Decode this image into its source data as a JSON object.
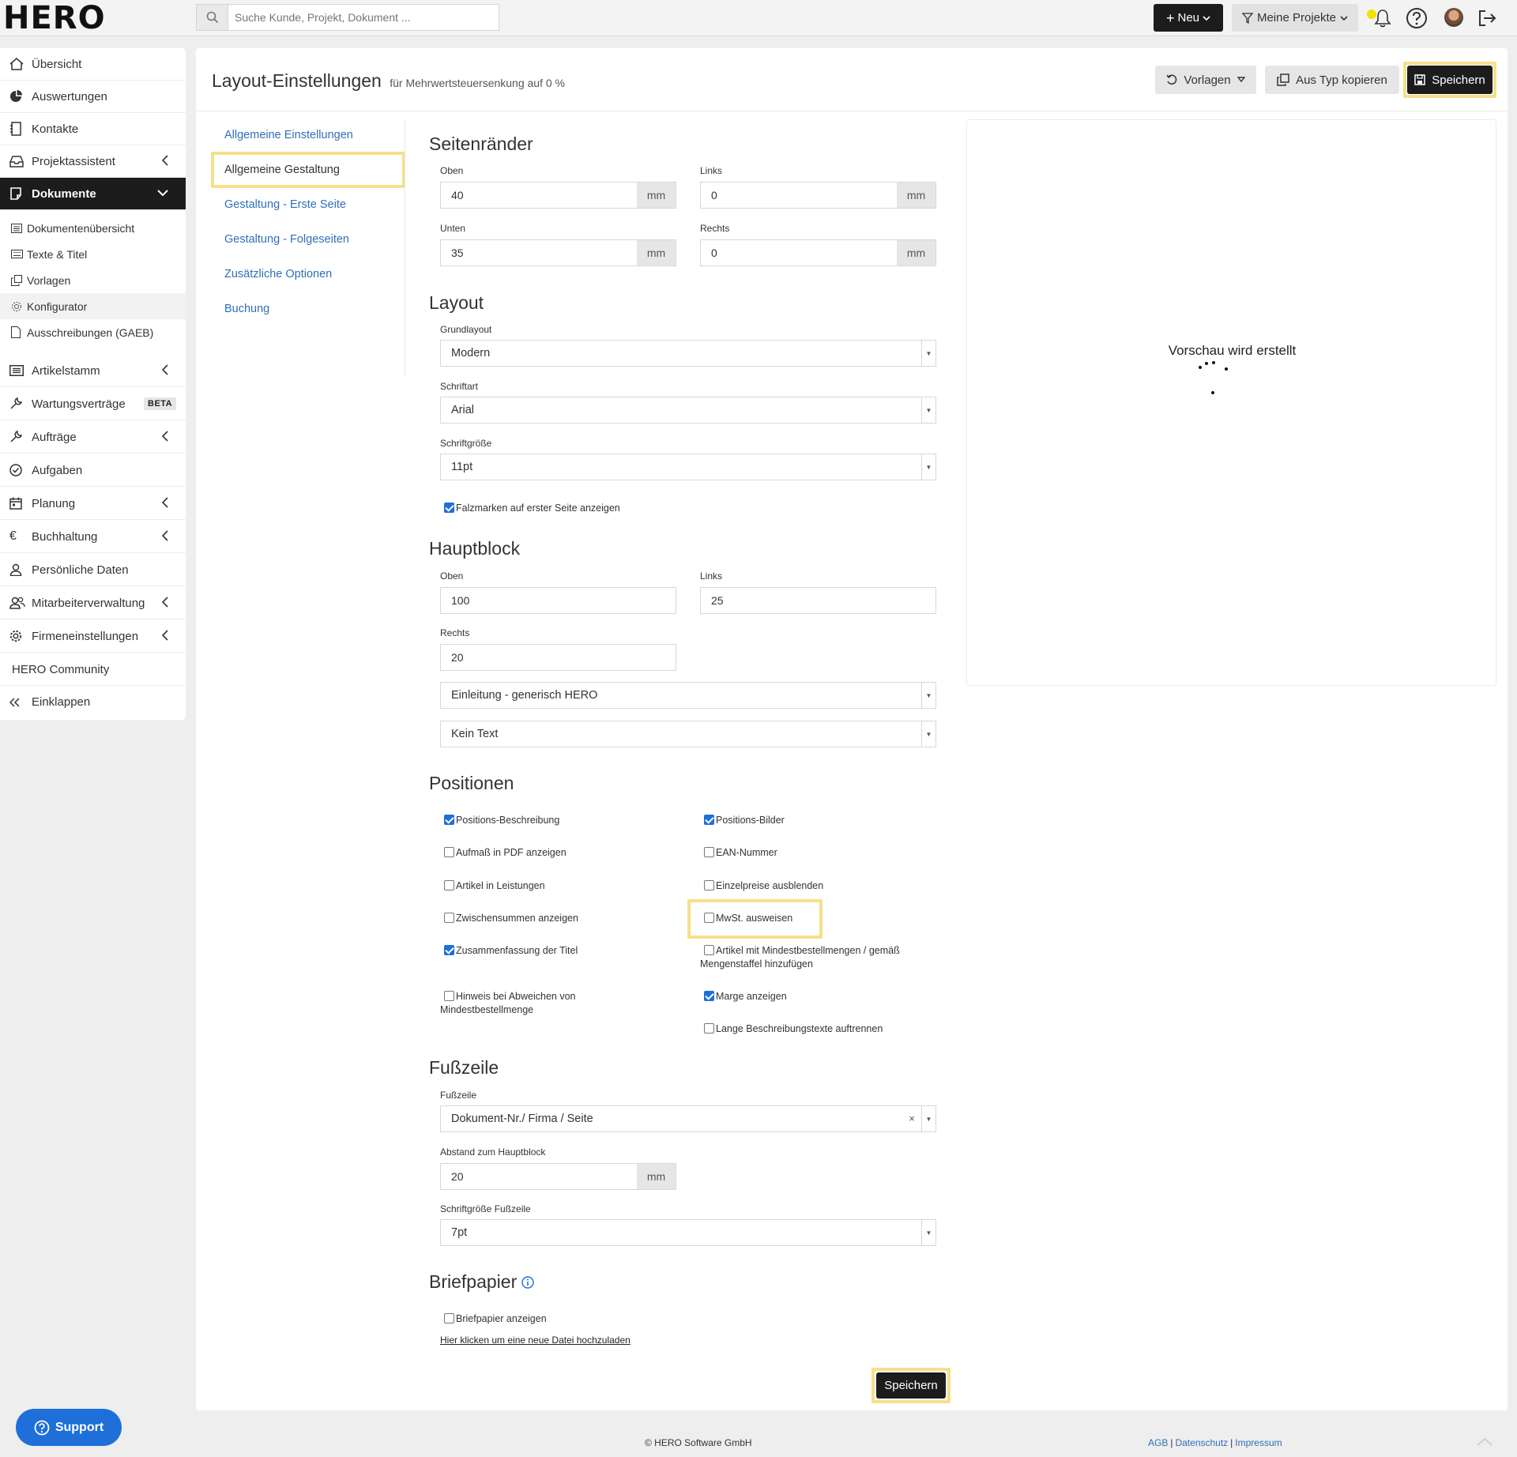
{
  "topbar": {
    "logo": "HERO",
    "search_placeholder": "Suche Kunde, Projekt, Dokument ...",
    "new_label": "Neu",
    "projects_label": "Meine Projekte"
  },
  "sidebar": {
    "items": [
      {
        "label": "Übersicht"
      },
      {
        "label": "Auswertungen"
      },
      {
        "label": "Kontakte"
      },
      {
        "label": "Projektassistent"
      },
      {
        "label": "Dokumente"
      }
    ],
    "sub_items": [
      {
        "label": "Dokumentenübersicht"
      },
      {
        "label": "Texte & Titel"
      },
      {
        "label": "Vorlagen"
      },
      {
        "label": "Konfigurator"
      },
      {
        "label": "Ausschreibungen (GAEB)"
      }
    ],
    "items2": [
      {
        "label": "Artikelstamm"
      },
      {
        "label": "Wartungsverträge",
        "badge": "BETA"
      },
      {
        "label": "Aufträge"
      },
      {
        "label": "Aufgaben"
      },
      {
        "label": "Planung"
      },
      {
        "label": "Buchhaltung"
      },
      {
        "label": "Persönliche Daten"
      },
      {
        "label": "Mitarbeiterverwaltung"
      },
      {
        "label": "Firmeneinstellungen"
      },
      {
        "label": "HERO Community"
      },
      {
        "label": "Einklappen"
      }
    ]
  },
  "header": {
    "title": "Layout-Einstellungen",
    "subtitle": "für Mehrwertsteuersenkung auf 0 %",
    "templates_label": "Vorlagen",
    "copy_label": "Aus Typ kopieren",
    "save_label": "Speichern"
  },
  "tabs": [
    {
      "label": "Allgemeine Einstellungen"
    },
    {
      "label": "Allgemeine Gestaltung"
    },
    {
      "label": "Gestaltung - Erste Seite"
    },
    {
      "label": "Gestaltung - Folgeseiten"
    },
    {
      "label": "Zusätzliche Optionen"
    },
    {
      "label": "Buchung"
    }
  ],
  "margins": {
    "title": "Seitenränder",
    "top_label": "Oben",
    "top_value": "40",
    "left_label": "Links",
    "left_value": "0",
    "bottom_label": "Unten",
    "bottom_value": "35",
    "right_label": "Rechts",
    "right_value": "0",
    "unit": "mm"
  },
  "layout": {
    "title": "Layout",
    "base_label": "Grundlayout",
    "base_value": "Modern",
    "font_label": "Schriftart",
    "font_value": "Arial",
    "size_label": "Schriftgröße",
    "size_value": "11pt",
    "fold_marks_label": "Falzmarken auf erster Seite anzeigen"
  },
  "mainblock": {
    "title": "Hauptblock",
    "top_label": "Oben",
    "top_value": "100",
    "left_label": "Links",
    "left_value": "25",
    "right_label": "Rechts",
    "right_value": "20",
    "intro_value": "Einleitung - generisch HERO",
    "text_value": "Kein Text"
  },
  "positions": {
    "title": "Positionen",
    "left": [
      {
        "label": "Positions-Beschreibung",
        "checked": true
      },
      {
        "label": "Aufmaß in PDF anzeigen",
        "checked": false
      },
      {
        "label": "Artikel in Leistungen",
        "checked": false
      },
      {
        "label": "Zwischensummen anzeigen",
        "checked": false
      },
      {
        "label": "Zusammenfassung der Titel",
        "checked": true
      },
      {
        "label": "Hinweis bei Abweichen von",
        "label2": "Mindestbestellmenge",
        "checked": false
      }
    ],
    "right": [
      {
        "label": "Positions-Bilder",
        "checked": true
      },
      {
        "label": "EAN-Nummer",
        "checked": false
      },
      {
        "label": "Einzelpreise ausblenden",
        "checked": false
      },
      {
        "label": "MwSt. ausweisen",
        "checked": false
      },
      {
        "label": "Artikel mit Mindestbestellmengen / gemäß",
        "label2": "Mengenstaffel hinzufügen",
        "checked": false
      },
      {
        "label": "Marge anzeigen",
        "checked": true
      },
      {
        "label": "Lange Beschreibungstexte auftrennen",
        "checked": false
      }
    ]
  },
  "footer_section": {
    "title": "Fußzeile",
    "footer_label": "Fußzeile",
    "footer_value": "Dokument-Nr./ Firma / Seite",
    "distance_label": "Abstand zum Hauptblock",
    "distance_value": "20",
    "unit": "mm",
    "size_label": "Schriftgröße Fußzeile",
    "size_value": "7pt"
  },
  "letterhead": {
    "title": "Briefpapier",
    "show_label": "Briefpapier anzeigen",
    "upload_link": "Hier klicken um eine neue Datei hochzuladen"
  },
  "preview": {
    "status": "Vorschau wird erstellt"
  },
  "save_bottom_label": "Speichern",
  "page_footer": {
    "support_label": "Support",
    "copyright": "© HERO Software GmbH",
    "links": [
      "AGB",
      "Datenschutz",
      "Impressum"
    ]
  },
  "colors": {
    "accent": "#1c1c1c",
    "link": "#2f6fb8",
    "highlight": "#f5e08a",
    "checkbox": "#1e6fd9"
  }
}
